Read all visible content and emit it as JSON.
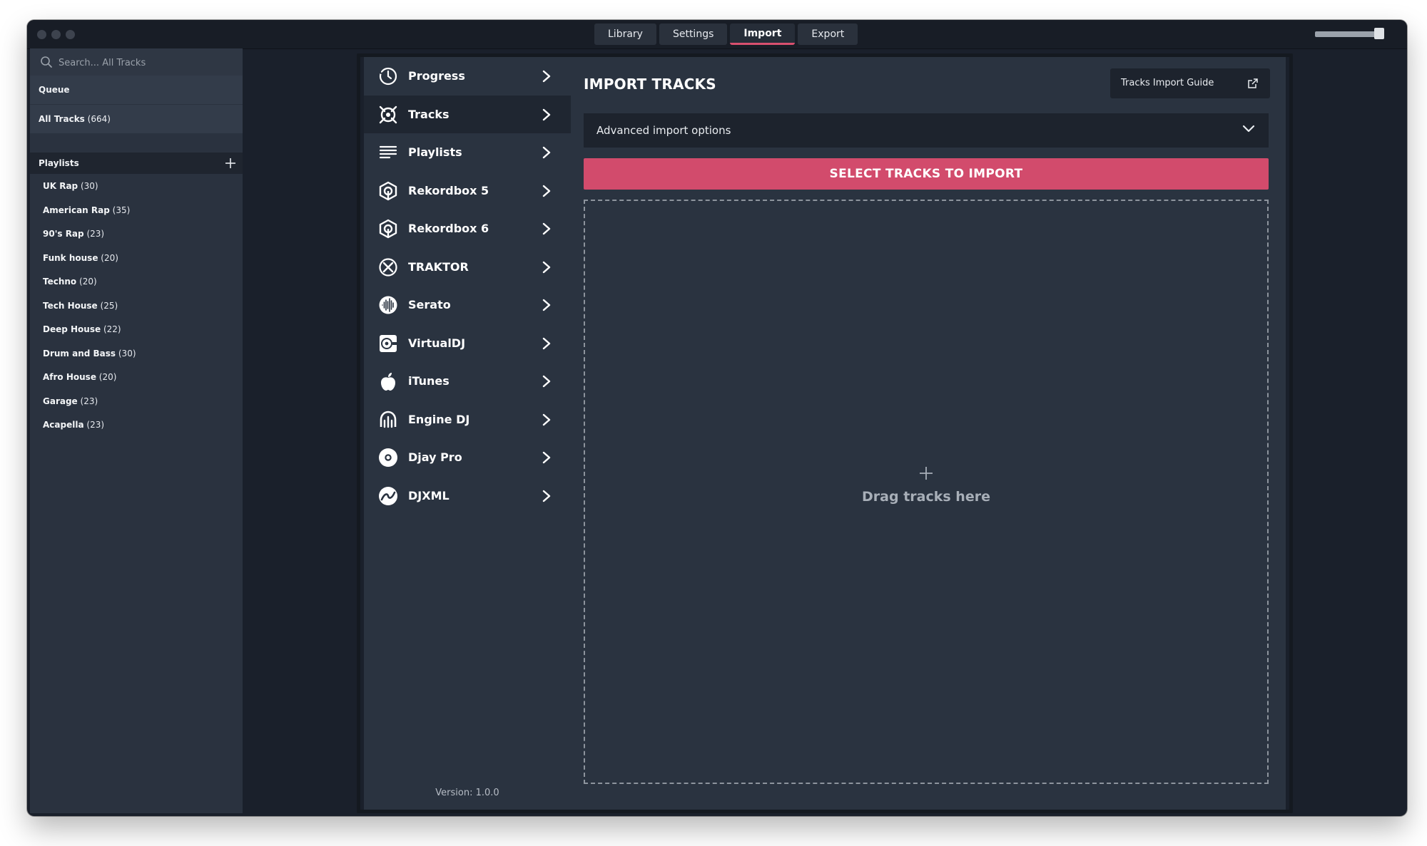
{
  "window": {
    "tabs": [
      {
        "label": "Library",
        "active": false
      },
      {
        "label": "Settings",
        "active": false
      },
      {
        "label": "Import",
        "active": true
      },
      {
        "label": "Export",
        "active": false
      }
    ],
    "volume_level": 0.96
  },
  "sidebar": {
    "search": {
      "placeholder": "Search... All Tracks",
      "value": ""
    },
    "queue_label": "Queue",
    "all_tracks": {
      "label": "All Tracks",
      "count": "(664)"
    },
    "playlists_header": "Playlists",
    "playlists": [
      {
        "name": "UK Rap",
        "count": "(30)"
      },
      {
        "name": "American Rap",
        "count": "(35)"
      },
      {
        "name": "90's Rap",
        "count": "(23)"
      },
      {
        "name": "Funk house",
        "count": "(20)"
      },
      {
        "name": "Techno",
        "count": "(20)"
      },
      {
        "name": "Tech House",
        "count": "(25)"
      },
      {
        "name": "Deep House",
        "count": "(22)"
      },
      {
        "name": "Drum and Bass",
        "count": "(30)"
      },
      {
        "name": "Afro House",
        "count": "(20)"
      },
      {
        "name": "Garage",
        "count": "(23)"
      },
      {
        "name": "Acapella",
        "count": "(23)"
      }
    ]
  },
  "nav": {
    "items": [
      {
        "label": "Progress",
        "icon": "clock-icon",
        "selected": false
      },
      {
        "label": "Tracks",
        "icon": "tracks-icon",
        "selected": true
      },
      {
        "label": "Playlists",
        "icon": "list-icon",
        "selected": false
      },
      {
        "label": "Rekordbox 5",
        "icon": "rekordbox-icon",
        "selected": false
      },
      {
        "label": "Rekordbox 6",
        "icon": "rekordbox-icon",
        "selected": false
      },
      {
        "label": "TRAKTOR",
        "icon": "traktor-icon",
        "selected": false
      },
      {
        "label": "Serato",
        "icon": "serato-icon",
        "selected": false
      },
      {
        "label": "VirtualDJ",
        "icon": "virtualdj-icon",
        "selected": false
      },
      {
        "label": "iTunes",
        "icon": "apple-icon",
        "selected": false
      },
      {
        "label": "Engine DJ",
        "icon": "engine-dj-icon",
        "selected": false
      },
      {
        "label": "Djay Pro",
        "icon": "djay-icon",
        "selected": false
      },
      {
        "label": "DJXML",
        "icon": "djxml-icon",
        "selected": false
      }
    ],
    "version": "Version: 1.0.0"
  },
  "main": {
    "title": "IMPORT TRACKS",
    "guide_button": "Tracks Import Guide",
    "advanced_options": "Advanced import options",
    "select_button": "SELECT TRACKS TO IMPORT",
    "dropzone_text": "Drag tracks here"
  },
  "colors": {
    "accent": "#d24b6c",
    "panel": "#2a3340",
    "background": "#1a202b"
  }
}
